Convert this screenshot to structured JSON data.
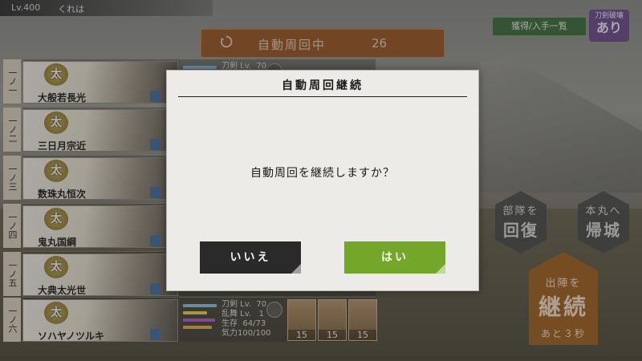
{
  "header": {
    "level": "Lv.400",
    "player_name": "くれは"
  },
  "auto_battle": {
    "label": "自動周回中",
    "count": "26"
  },
  "top_right": {
    "drops_button": "獲得/入手一覧",
    "break_label_top": "刀剣破壊",
    "break_label_bottom": "あり"
  },
  "units": [
    {
      "slot": "一ノ一",
      "type": "太",
      "name": "大般若長光"
    },
    {
      "slot": "一ノ二",
      "type": "太",
      "name": "三日月宗近"
    },
    {
      "slot": "一ノ三",
      "type": "太",
      "name": "数珠丸恒次"
    },
    {
      "slot": "一ノ四",
      "type": "太",
      "name": "鬼丸国綱"
    },
    {
      "slot": "一ノ五",
      "type": "太",
      "name": "大典太光世"
    },
    {
      "slot": "一ノ六",
      "type": "太",
      "name": "ソハヤノツルキ",
      "stats": {
        "sword_lv": "刀剣 Lv.  70",
        "troop_lv": "乱舞 Lv.   1",
        "life": "生存  64/73",
        "mood": "気力100/100"
      },
      "items": [
        "15",
        "15",
        "15"
      ]
    }
  ],
  "first_row_stat": "刀剣 Lv.  70",
  "side_buttons": {
    "heal_small": "部隊を",
    "heal_big": "回復",
    "return_small": "本丸へ",
    "return_big": "帰城",
    "sortie_small": "出陣を",
    "sortie_big": "継続",
    "countdown": "あと３秒"
  },
  "modal": {
    "title": "自動周回継続",
    "message": "自動周回を継続しますか？",
    "no_label": "いいえ",
    "yes_label": "はい"
  },
  "colors": {
    "yes": "#74a62a",
    "no": "#2a2a2a",
    "auto_bar": "#9c4d12",
    "sortie": "#a06120"
  }
}
